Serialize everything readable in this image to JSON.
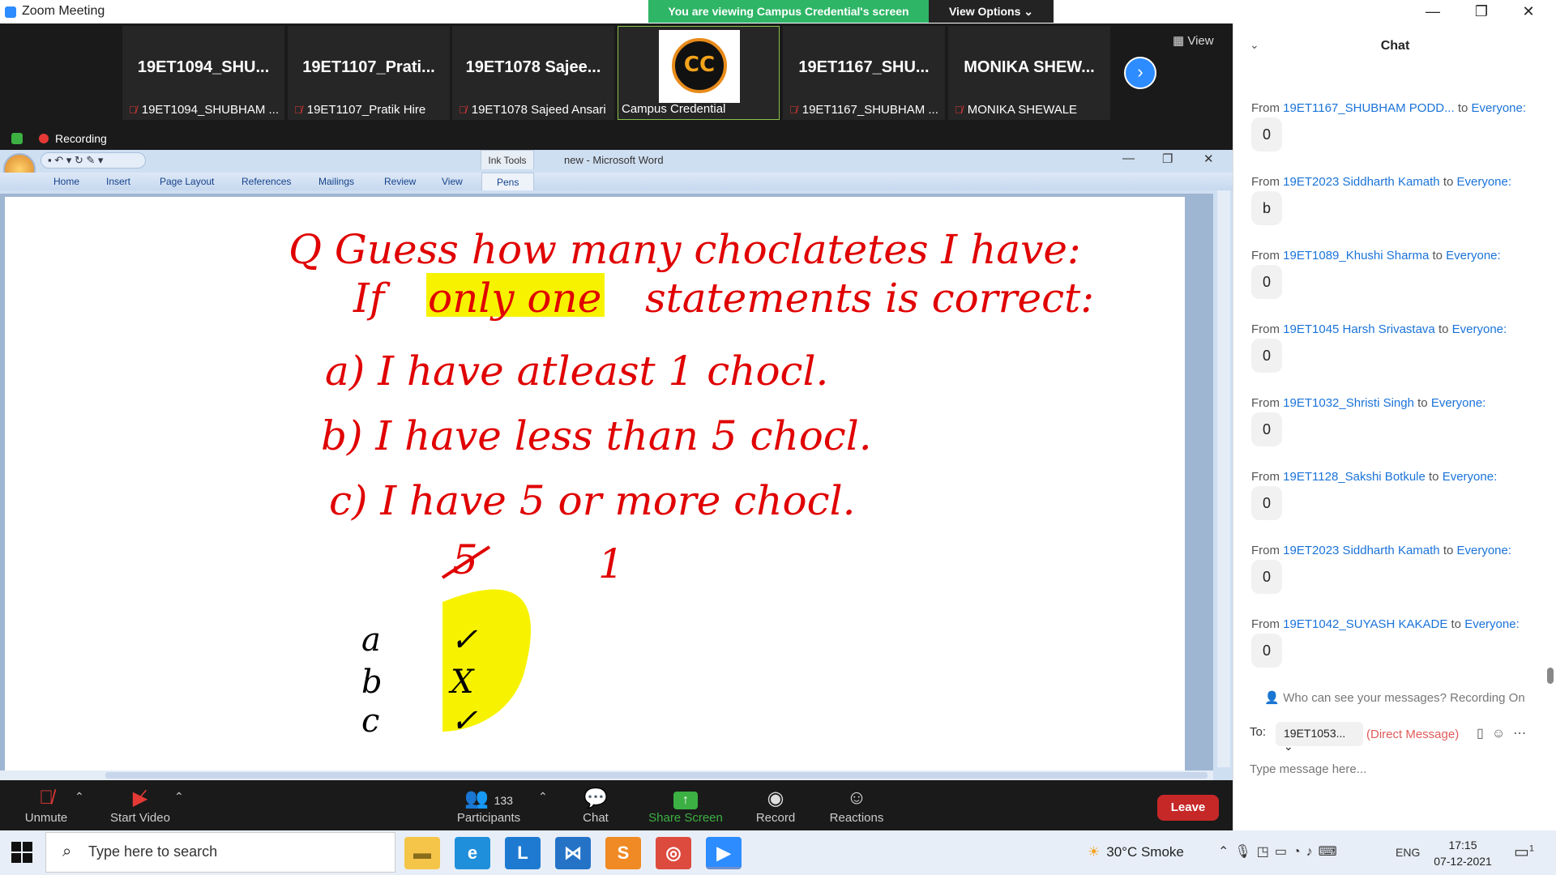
{
  "window": {
    "title": "Zoom Meeting",
    "controls": {
      "minimize": "—",
      "maximize": "❐",
      "close": "✕"
    }
  },
  "share_banner": {
    "viewing": "You are viewing Campus Credential's screen",
    "view_options": "View Options ⌄"
  },
  "gallery": {
    "tiles": [
      {
        "big": "19ET1094_SHU...",
        "name": "19ET1094_SHUBHAM ..."
      },
      {
        "big": "19ET1107_Prati...",
        "name": "19ET1107_Pratik Hire"
      },
      {
        "big": "19ET1078  Sajee...",
        "name": "19ET1078 Sajeed Ansari"
      },
      {
        "big": "",
        "name": "Campus Credential",
        "logo_text": "CC"
      },
      {
        "big": "19ET1167_SHU...",
        "name": "19ET1167_SHUBHAM ..."
      },
      {
        "big": "MONIKA  SHEW...",
        "name": "MONIKA SHEWALE"
      }
    ],
    "next_label": "›",
    "view_label": "View",
    "recording_label": "Recording"
  },
  "word": {
    "title": "new - Microsoft Word",
    "ink_tools": "Ink Tools",
    "tabs": [
      "Home",
      "Insert",
      "Page Layout",
      "References",
      "Mailings",
      "Review",
      "View",
      "Pens"
    ],
    "handwriting": {
      "line1": "Q Guess how many choclatetes I have:",
      "line2_pre": "If",
      "line2_highlight": "only one",
      "line2_post": "statements is correct:",
      "line3": "a) I have atleast 1 chocl.",
      "line4": "b) I have less than 5 chocl.",
      "line5": "c) I have 5 or more chocl.",
      "struck": "5",
      "answer": "1",
      "rows": [
        {
          "label": "a",
          "mark": "✓"
        },
        {
          "label": "b",
          "mark": "X"
        },
        {
          "label": "c",
          "mark": "✓"
        }
      ]
    }
  },
  "chat": {
    "title": "Chat",
    "messages": [
      {
        "from": "19ET1167_SHUBHAM PODD...",
        "to": "Everyone:",
        "text": "0"
      },
      {
        "from": "19ET2023 Siddharth Kamath",
        "to": "Everyone:",
        "text": "b"
      },
      {
        "from": "19ET1089_Khushi Sharma",
        "to": "Everyone:",
        "text": "0"
      },
      {
        "from": "19ET1045 Harsh Srivastava",
        "to": "Everyone:",
        "text": "0"
      },
      {
        "from": "19ET1032_Shristi Singh",
        "to": "Everyone:",
        "text": "0"
      },
      {
        "from": "19ET1128_Sakshi Botkule",
        "to": "Everyone:",
        "text": "0"
      },
      {
        "from": "19ET2023 Siddharth Kamath",
        "to": "Everyone:",
        "text": "0"
      },
      {
        "from": "19ET1042_SUYASH KAKADE",
        "to": "Everyone:",
        "text": "0"
      }
    ],
    "from_word": "From",
    "to_word": "to",
    "privacy": "Who can see your messages? Recording On",
    "to_label": "To:",
    "recipient": "19ET1053...",
    "dm_label": "(Direct Message)",
    "input_placeholder": "Type message here..."
  },
  "toolbar": {
    "unmute": "Unmute",
    "start_video": "Start Video",
    "participants": "Participants",
    "participants_count": "133",
    "chat": "Chat",
    "share_screen": "Share Screen",
    "record": "Record",
    "reactions": "Reactions",
    "leave": "Leave"
  },
  "taskbar": {
    "search_placeholder": "Type here to search",
    "weather": "30°C  Smoke",
    "lang": "ENG",
    "time": "17:15",
    "date": "07-12-2021",
    "notifications": "1"
  },
  "colors": {
    "zoom_blue": "#2d8cff",
    "share_green": "#2eb566",
    "leave_red": "#c62828",
    "ink_red": "#e00000",
    "highlight_yellow": "#f7f300"
  }
}
